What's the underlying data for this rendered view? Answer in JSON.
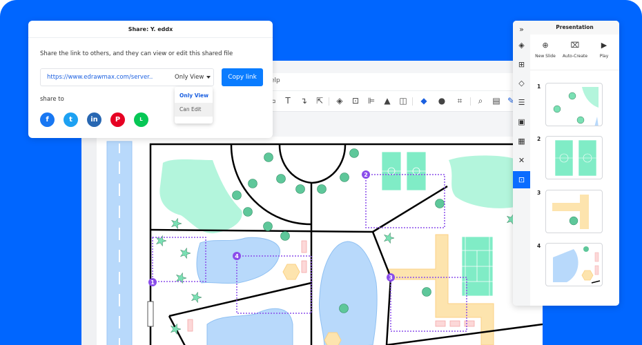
{
  "share_dialog": {
    "title": "Share: Y. eddx",
    "description": "Share the link to others, and they can view or edit this shared file",
    "link_url": "https://www.edrawmax.com/server..",
    "permission_selected": "Only View",
    "copy_button": "Copy link",
    "share_to_label": "share to",
    "permission_options": [
      "Only View",
      "Can Edit"
    ],
    "social_icons": [
      {
        "name": "facebook",
        "glyph": "f",
        "color": "#1877f2"
      },
      {
        "name": "twitter",
        "glyph": "t",
        "color": "#1da1f2"
      },
      {
        "name": "linkedin",
        "glyph": "in",
        "color": "#2867b2"
      },
      {
        "name": "pinterest",
        "glyph": "P",
        "color": "#e60023"
      },
      {
        "name": "line",
        "glyph": "L",
        "color": "#06c755"
      }
    ]
  },
  "editor": {
    "menu_partial": "elp",
    "toolbar_icons": [
      "rectangle",
      "text",
      "connector",
      "pointer",
      "layers",
      "group",
      "align",
      "flip",
      "frame",
      "fill",
      "shape-style",
      "crop",
      "search",
      "format-panel",
      "pen"
    ]
  },
  "presentation_panel": {
    "title": "Presentation",
    "actions": [
      {
        "label": "New Slide",
        "icon": "plus-circle-icon",
        "glyph": "⊕"
      },
      {
        "label": "Auto-Create",
        "icon": "presentation-board-icon",
        "glyph": "⌧"
      },
      {
        "label": "Play",
        "icon": "play-icon",
        "glyph": "▶"
      }
    ],
    "rail_icons": [
      "collapse",
      "fill",
      "grid",
      "layers",
      "list",
      "image",
      "attachment",
      "shuffle",
      "presentation"
    ],
    "slides": [
      {
        "number": "1"
      },
      {
        "number": "2"
      },
      {
        "number": "3"
      },
      {
        "number": "4"
      }
    ]
  },
  "map": {
    "markers": [
      "1",
      "2",
      "3",
      "4"
    ],
    "colors": {
      "lawn": "#b3f5dc",
      "water": "#b8d9fb",
      "path": "#fde4ae",
      "pitch": "#80ecc6",
      "tree": "#5ec79a",
      "frame": "#8a4dea",
      "bench": "#fcd8d8"
    }
  },
  "colors": {
    "brand_blue": "#0066ff",
    "button_blue": "#0a7cff"
  }
}
